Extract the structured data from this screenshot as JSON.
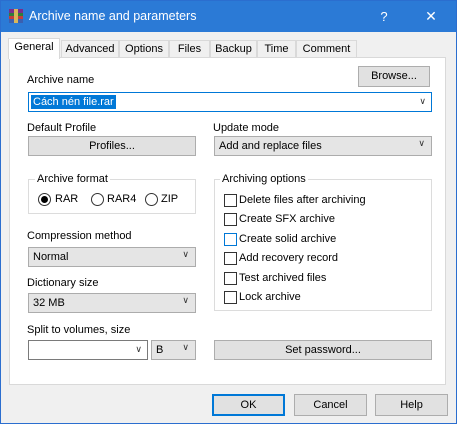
{
  "window": {
    "title": "Archive name and parameters",
    "help_glyph": "?",
    "close_glyph": "✕"
  },
  "tabs": [
    {
      "label": "General",
      "active": true
    },
    {
      "label": "Advanced"
    },
    {
      "label": "Options"
    },
    {
      "label": "Files"
    },
    {
      "label": "Backup"
    },
    {
      "label": "Time"
    },
    {
      "label": "Comment"
    }
  ],
  "archive_name": {
    "label": "Archive name",
    "browse_label": "Browse...",
    "value": "Cách nén file.rar"
  },
  "default_profile": {
    "label": "Default Profile",
    "button_label": "Profiles..."
  },
  "update_mode": {
    "label": "Update mode",
    "value": "Add and replace files"
  },
  "archive_format": {
    "label": "Archive format",
    "options": [
      {
        "label": "RAR",
        "selected": true
      },
      {
        "label": "RAR4"
      },
      {
        "label": "ZIP"
      }
    ]
  },
  "archiving_options": {
    "label": "Archiving options",
    "items": [
      {
        "label": "Delete files after archiving"
      },
      {
        "label": "Create SFX archive"
      },
      {
        "label": "Create solid archive"
      },
      {
        "label": "Add recovery record"
      },
      {
        "label": "Test archived files"
      },
      {
        "label": "Lock archive"
      }
    ]
  },
  "compression_method": {
    "label": "Compression method",
    "value": "Normal"
  },
  "dictionary_size": {
    "label": "Dictionary size",
    "value": "32 MB"
  },
  "split_volumes": {
    "label": "Split to volumes, size",
    "value": "",
    "unit": "B"
  },
  "set_password_label": "Set password...",
  "footer": {
    "ok": "OK",
    "cancel": "Cancel",
    "help": "Help"
  },
  "colors": {
    "titlebar": "#2b7ad6",
    "selection": "#0078d7",
    "accent_border": "#0078d7"
  }
}
